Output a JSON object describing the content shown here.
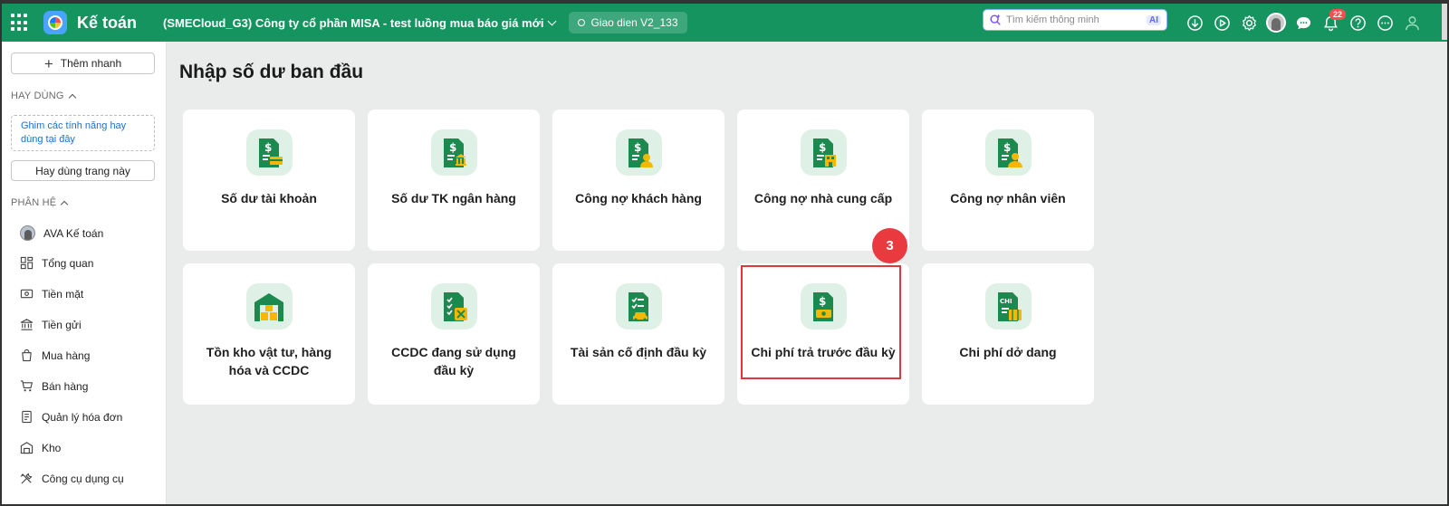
{
  "header": {
    "app_title": "Kế toán",
    "company": "(SMECloud_G3) Công ty cổ phần MISA - test luồng mua báo giá mới",
    "version": "Giao dien V2_133",
    "search_placeholder": "Tìm kiếm thông minh",
    "search_ai": "AI",
    "notification_count": "22",
    "icons": [
      "download-icon",
      "play-icon",
      "gear-icon",
      "user-avatar",
      "chat-icon",
      "bell-icon",
      "help-icon",
      "more-icon",
      "account-icon"
    ]
  },
  "sidebar": {
    "quick_add": "Thêm nhanh",
    "frequent_title": "HAY DÙNG",
    "pin_hint": "Ghim các tính năng hay dùng tại đây",
    "frequent_button": "Hay dùng trang này",
    "modules_title": "PHÂN HỆ",
    "items": [
      {
        "label": "AVA Kế toán",
        "icon": "avatar"
      },
      {
        "label": "Tổng quan",
        "icon": "dashboard-icon"
      },
      {
        "label": "Tiền mặt",
        "icon": "cash-icon"
      },
      {
        "label": "Tiền gửi",
        "icon": "bank-icon"
      },
      {
        "label": "Mua hàng",
        "icon": "shopping-bag-icon"
      },
      {
        "label": "Bán hàng",
        "icon": "cart-icon"
      },
      {
        "label": "Quản lý hóa đơn",
        "icon": "invoice-icon"
      },
      {
        "label": "Kho",
        "icon": "warehouse-icon"
      },
      {
        "label": "Công cụ dụng cụ",
        "icon": "tools-icon"
      }
    ]
  },
  "main": {
    "title": "Nhập số dư ban đầu",
    "step_badge": "3",
    "cards": [
      {
        "label": "Số dư tài khoản",
        "icon": "account-balance-icon"
      },
      {
        "label": "Số dư TK ngân hàng",
        "icon": "bank-balance-icon"
      },
      {
        "label": "Công nợ khách hàng",
        "icon": "customer-debt-icon"
      },
      {
        "label": "Công nợ nhà cung cấp",
        "icon": "supplier-debt-icon"
      },
      {
        "label": "Công nợ nhân viên",
        "icon": "employee-debt-icon"
      },
      {
        "label": "Tồn kho vật tư, hàng hóa và CCDC",
        "icon": "inventory-icon"
      },
      {
        "label": "CCDC đang sử dụng đầu kỳ",
        "icon": "tools-in-use-icon"
      },
      {
        "label": "Tài sản cố định đầu kỳ",
        "icon": "fixed-asset-icon"
      },
      {
        "label": "Chi phí trả trước đầu kỳ",
        "icon": "prepaid-expense-icon"
      },
      {
        "label": "Chi phí dở dang",
        "icon": "wip-cost-icon"
      }
    ],
    "colors": {
      "brand": "#159460",
      "icon_dark": "#1c8a4f",
      "icon_accent": "#f5b800",
      "highlight": "#e0373d"
    }
  }
}
